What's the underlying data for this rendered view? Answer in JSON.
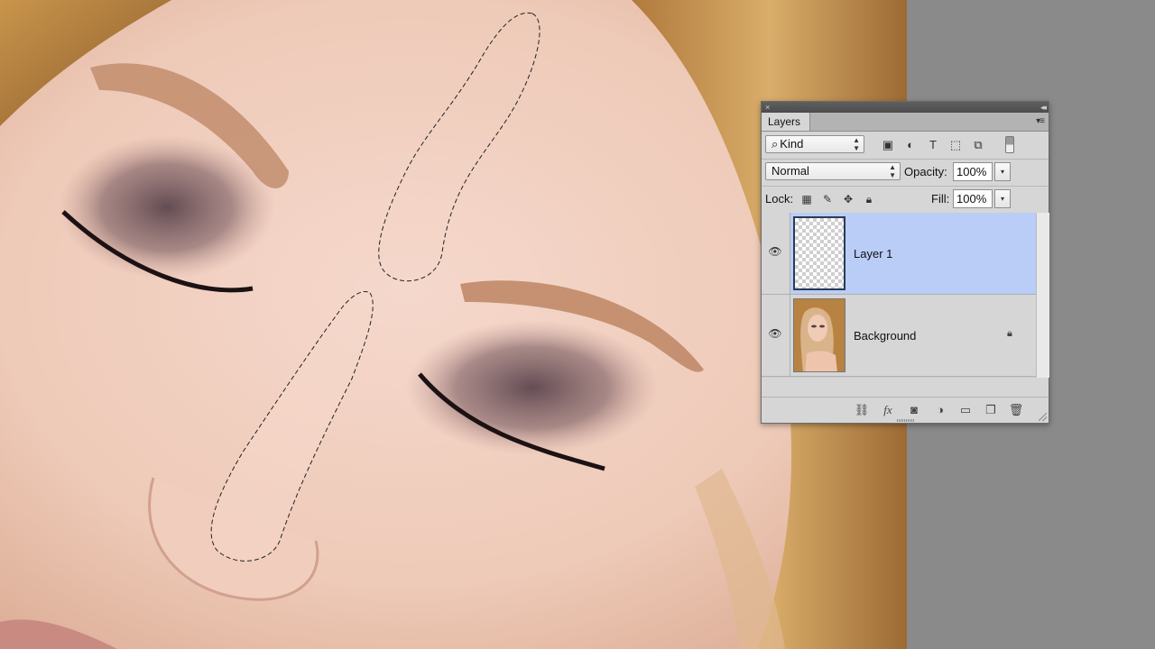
{
  "panel": {
    "tab_label": "Layers",
    "filter": {
      "kind_label": "Kind",
      "icons": [
        "image-filter-icon",
        "adjustment-filter-icon",
        "type-filter-icon",
        "shape-filter-icon",
        "smart-object-filter-icon"
      ],
      "type_glyph": "T"
    },
    "blend_mode": "Normal",
    "opacity_label": "Opacity:",
    "opacity_value": "100%",
    "lock_label": "Lock:",
    "fill_label": "Fill:",
    "fill_value": "100%",
    "layers": [
      {
        "name": "Layer 1",
        "selected": true,
        "visible": true,
        "thumbnail": "transparent"
      },
      {
        "name": "Background",
        "selected": false,
        "visible": true,
        "thumbnail": "photo",
        "locked": true
      }
    ],
    "footer_icons": [
      "link-layers-icon",
      "fx-icon",
      "layer-mask-icon",
      "adjustment-layer-icon",
      "group-folder-icon",
      "new-layer-icon",
      "trash-icon"
    ],
    "fx_label": "fx"
  },
  "colors": {
    "selection_highlight": "#b9cdf7",
    "panel_bg": "#d6d6d6",
    "pasteboard": "#8a8a8a"
  }
}
